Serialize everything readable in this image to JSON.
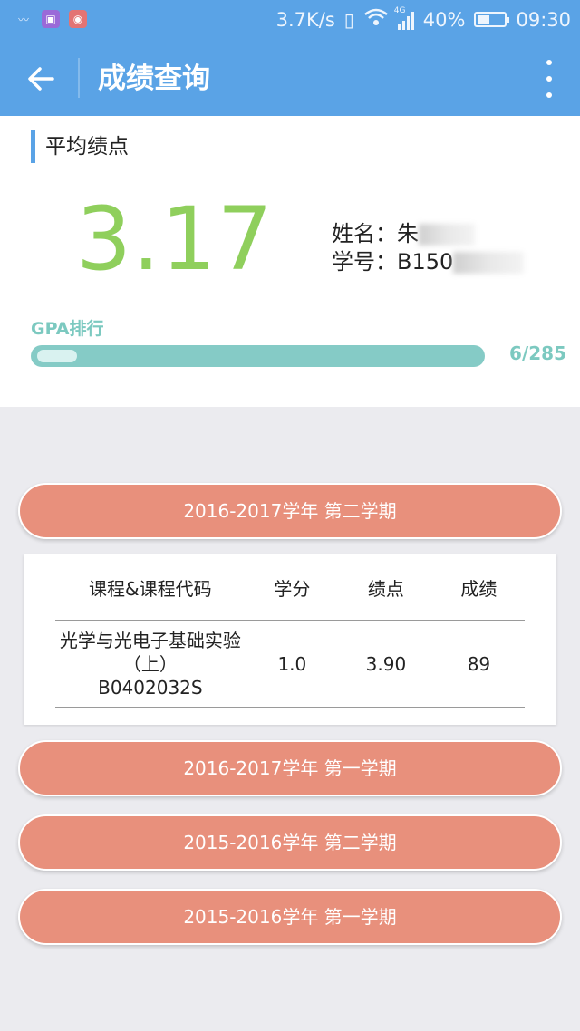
{
  "status_bar": {
    "speed": "3.7K/s",
    "network": "4G",
    "battery": "40%",
    "time": "09:30"
  },
  "app_bar": {
    "title": "成绩查询"
  },
  "section": {
    "title": "平均绩点"
  },
  "gpa": {
    "value": "3.17",
    "name_label": "姓名：",
    "name_value": "朱",
    "id_label": "学号：",
    "id_value": "B150",
    "rank_label": "GPA排行",
    "rank_text": "6/285",
    "rank_fraction": 0.021
  },
  "terms": [
    {
      "label": "2016-2017学年 第二学期"
    },
    {
      "label": "2016-2017学年 第一学期"
    },
    {
      "label": "2015-2016学年 第二学期"
    },
    {
      "label": "2015-2016学年 第一学期"
    }
  ],
  "table": {
    "headers": [
      "课程&课程代码",
      "学分",
      "绩点",
      "成绩"
    ],
    "rows": [
      {
        "course": "光学与光电子基础实验（上）",
        "code": "B0402032S",
        "credit": "1.0",
        "gp": "3.90",
        "score": "89"
      }
    ]
  },
  "colors": {
    "primary": "#5aa3e6",
    "gpa": "#8fcf5c",
    "rank": "#85cbc6",
    "term": "#e8907c"
  },
  "icons": [
    "activity-icon",
    "photo-icon",
    "app-icon",
    "vibrate-icon",
    "wifi-icon",
    "signal-icon",
    "battery-icon",
    "back-arrow-icon",
    "more-vert-icon"
  ]
}
